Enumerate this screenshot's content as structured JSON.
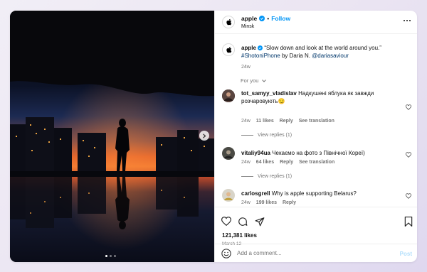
{
  "account": {
    "username": "apple",
    "follow_label": "Follow",
    "separator": "•",
    "location": "Minsk"
  },
  "caption": {
    "username": "apple",
    "text": "“Slow down and look at the world around you.”",
    "hashtag": "#ShotoniPhone",
    "by": " by Daria N. ",
    "mention": "@dariasaviour",
    "time": "24w"
  },
  "for_you_label": "For you",
  "comments": [
    {
      "username": "tot_samyy_vladislav",
      "text": "Надкушені яблука як завжди розчаровують",
      "emoji": "😏",
      "time": "24w",
      "likes": "11 likes",
      "reply": "Reply",
      "translate": "See translation",
      "view_replies": "View replies (1)"
    },
    {
      "username": "vitaliy94ua",
      "text": "Чекаємо на фото з Північної Кореї)",
      "time": "24w",
      "likes": "64 likes",
      "reply": "Reply",
      "translate": "See translation",
      "view_replies": "View replies (1)"
    },
    {
      "username": "carlosgrell",
      "text": "Why is apple supporting Belarus?",
      "time": "24w",
      "likes": "199 likes",
      "reply": "Reply"
    }
  ],
  "post_stats": {
    "likes": "121,381 likes",
    "date": "March 12"
  },
  "comment_box": {
    "placeholder": "Add a comment...",
    "post_label": "Post"
  },
  "carousel": {
    "current": 1,
    "total": 3
  },
  "colors": {
    "follow_blue": "#0095f6",
    "verified_blue": "#0095f6",
    "link": "#00376b",
    "muted": "#737373",
    "post_disabled": "#b2dffc"
  }
}
